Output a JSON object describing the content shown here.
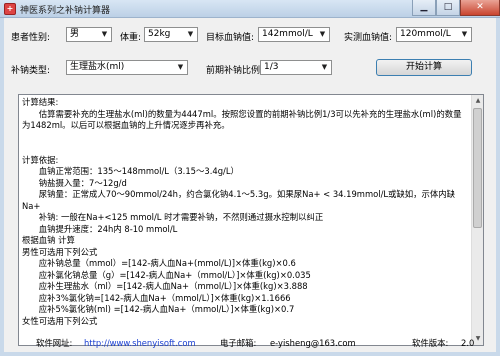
{
  "window": {
    "title": "神医系列之补钠计算器",
    "icon": "app-icon",
    "controls": {
      "minimize": "▁",
      "maximize": "□",
      "close": "✕"
    }
  },
  "form": {
    "gender_label": "患者性别:",
    "gender_value": "男",
    "weight_label": "体重:",
    "weight_value": "52kg",
    "target_label": "目标血钠值:",
    "target_value": "142mmol/L",
    "measured_label": "实测血钠值:",
    "measured_value": "120mmol/L",
    "type_label": "补钠类型:",
    "type_value": "生理盐水(ml)",
    "ratio_label": "前期补钠比例:",
    "ratio_value": "1/3",
    "start_button": "开始计算"
  },
  "result": {
    "lines": [
      "计算结果:",
      "　　估算需要补充的生理盐水(ml)的数量为4447ml。按照您设置的前期补钠比例1/3可以先补充的生理盐水(ml)的数量为1482ml。以后可以根据血钠的上升情况逐步再补充。",
      "",
      "",
      "计算依据:",
      "　　血钠正常范围：135～148mmol/L（3.15～3.4g/L）",
      "　　钠盐摄入量：7～12g/d",
      "　　尿钠量：正常成人70～90mmol/24h，约合氯化钠4.1～5.3g。如果尿Na+ < 34.19mmol/L或缺如，示体内缺Na+",
      "　　补钠: 一般在Na+<125 mmol/L 时才需要补钠，不然则通过摄水控制以纠正",
      "　　血钠提升速度：24h内 8-10 mmol/L",
      "根据血钠 计算",
      "男性可选用下列公式",
      "　　应补钠总量（mmol）=[142-病人血Na+(mmol/L)]×体重(kg)×0.6",
      "　　应补氯化钠总量（g）=[142-病人血Na+（mmol/L）]×体重(kg)×0.035",
      "　　应补生理盐水（ml）=[142-病人血Na+（mmol/L）]×体重(kg)×3.888",
      "　　应补3%氯化钠=[142-病人血Na+（mmol/L）]×体重(kg)×1.1666",
      "　　应补5%氯化钠(ml) =[142-病人血Na+（mmol/L）]×体重(kg)×0.7",
      "女性可选用下列公式"
    ]
  },
  "status": {
    "website_label": "软件网址:",
    "website_url": "http://www.shenyisoft.com",
    "email_label": "电子邮箱:",
    "email_value": "e-yisheng@163.com",
    "version_label": "软件版本:",
    "version_value": "2.0"
  }
}
